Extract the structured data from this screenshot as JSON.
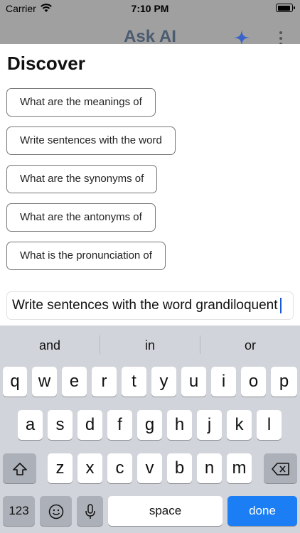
{
  "status_bar": {
    "carrier": "Carrier",
    "time": "7:10 PM"
  },
  "nav": {
    "title": "Ask AI"
  },
  "discover": {
    "title": "Discover",
    "chips": [
      "What are the meanings of",
      "Write sentences with the word",
      "What are the synonyms of",
      "What are the antonyms of",
      "What is the pronunciation of"
    ]
  },
  "input": {
    "value": "Write sentences with the word grandiloquent"
  },
  "keyboard": {
    "suggestions": [
      "and",
      "in",
      "or"
    ],
    "row1": [
      "q",
      "w",
      "e",
      "r",
      "t",
      "y",
      "u",
      "i",
      "o",
      "p"
    ],
    "row2": [
      "a",
      "s",
      "d",
      "f",
      "g",
      "h",
      "j",
      "k",
      "l"
    ],
    "row3": [
      "z",
      "x",
      "c",
      "v",
      "b",
      "n",
      "m"
    ],
    "numbers_label": "123",
    "space_label": "space",
    "done_label": "done"
  },
  "colors": {
    "accent": "#1b7ef5",
    "sparkle": "#3a63c9"
  }
}
